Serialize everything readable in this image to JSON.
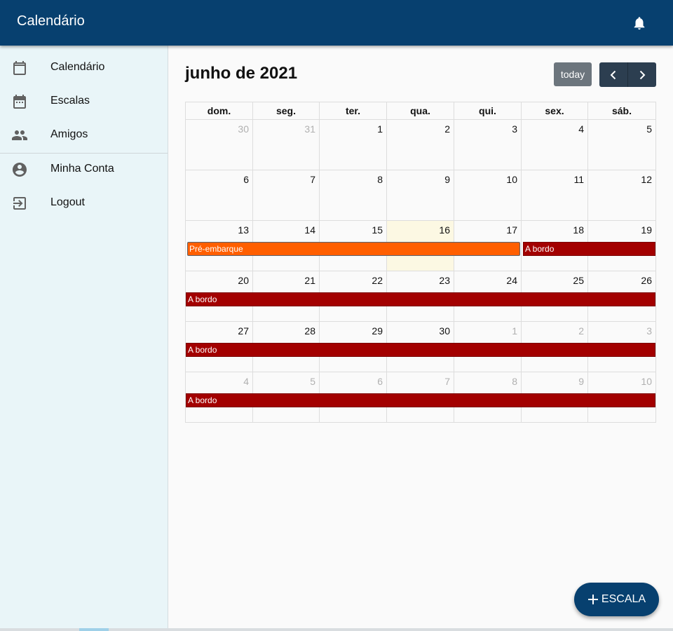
{
  "app": {
    "title": "Calendário"
  },
  "colors": {
    "appbar": "#07406f",
    "pre_embarque": "#ff5f00",
    "a_bordo": "#a30000",
    "today_bg": "#fcf8e3"
  },
  "sidebar": {
    "items": [
      {
        "label": "Calendário",
        "icon": "calendar-icon"
      },
      {
        "label": "Escalas",
        "icon": "calendar-event-icon"
      },
      {
        "label": "Amigos",
        "icon": "people-icon"
      },
      {
        "label": "Minha Conta",
        "icon": "account-circle-icon"
      },
      {
        "label": "Logout",
        "icon": "logout-icon"
      }
    ]
  },
  "calendar": {
    "title": "junho de 2021",
    "today_label": "today",
    "days_of_week": [
      "dom.",
      "seg.",
      "ter.",
      "qua.",
      "qui.",
      "sex.",
      "sáb."
    ],
    "weeks": [
      [
        "30",
        "31",
        "1",
        "2",
        "3",
        "4",
        "5"
      ],
      [
        "6",
        "7",
        "8",
        "9",
        "10",
        "11",
        "12"
      ],
      [
        "13",
        "14",
        "15",
        "16",
        "17",
        "18",
        "19"
      ],
      [
        "20",
        "21",
        "22",
        "23",
        "24",
        "25",
        "26"
      ],
      [
        "27",
        "28",
        "29",
        "30",
        "1",
        "2",
        "3"
      ],
      [
        "4",
        "5",
        "6",
        "7",
        "8",
        "9",
        "10"
      ]
    ],
    "events": {
      "pre_embarque": "Pré-embarque",
      "a_bordo": "A bordo"
    }
  },
  "fab": {
    "label": "ESCALA",
    "icon": "plus-icon"
  }
}
